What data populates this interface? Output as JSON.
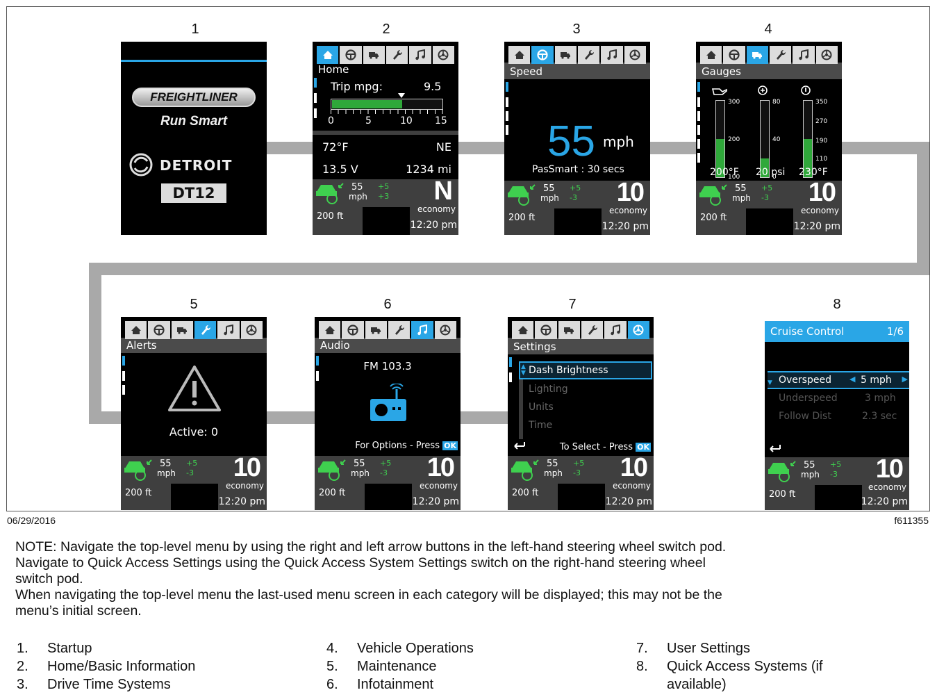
{
  "screens": [
    {
      "num": "1",
      "title": "",
      "brand1": "FREIGHTLINER",
      "brand2": "Run Smart",
      "brand3": "DETROIT",
      "brand4": "DT12"
    },
    {
      "num": "2",
      "title": "Home",
      "trip_label": "Trip mpg:",
      "trip_value": "9.5",
      "scale": [
        "0",
        "5",
        "10",
        "15"
      ],
      "temp": "72°F",
      "heading": "NE",
      "voltage": "13.5 V",
      "odometer": "1234 mi",
      "gear": "N"
    },
    {
      "num": "3",
      "title": "Speed",
      "speed": "55",
      "unit": "mph",
      "passmart": "PasSmart : 30 secs",
      "gear": "10"
    },
    {
      "num": "4",
      "title": "Gauges",
      "gauge1": {
        "max": "300",
        "mid": "200",
        "min": "100",
        "value": "200°F"
      },
      "gauge2": {
        "max": "80",
        "mid": "40",
        "min": "0",
        "value": "20 psi"
      },
      "gauge3": {
        "max": "350",
        "t2": "270",
        "t3": "190",
        "min": "110",
        "value": "230°F"
      },
      "gear": "10"
    },
    {
      "num": "5",
      "title": "Alerts",
      "active": "Active: 0",
      "gear": "10"
    },
    {
      "num": "6",
      "title": "Audio",
      "station": "FM 103.3",
      "options": "For Options - Press",
      "ok": "OK",
      "gear": "10"
    },
    {
      "num": "7",
      "title": "Settings",
      "items": [
        "Dash Brightness",
        "Lighting",
        "Units",
        "Time"
      ],
      "select": "To Select - Press",
      "ok": "OK",
      "gear": "10"
    },
    {
      "num": "8",
      "title": "Cruise Control",
      "page": "1/6",
      "rows": [
        {
          "label": "Overspeed",
          "value": "5 mph"
        },
        {
          "label": "Underspeed",
          "value": "3 mph"
        },
        {
          "label": "Follow Dist",
          "value": "2.3 sec"
        }
      ],
      "gear": "10"
    }
  ],
  "status": {
    "speed": "55",
    "unit": "mph",
    "plus": "+5",
    "minus": "-3",
    "minus_n": "+3",
    "economy": "economy",
    "time": "12:20 pm",
    "distance": "200 ft"
  },
  "footer": {
    "date": "06/29/2016",
    "code": "f611355"
  },
  "note": [
    "NOTE: Navigate the top-level menu by using the right and left arrow buttons in the left-hand steering wheel switch pod.",
    "Navigate to Quick Access Settings using the Quick Access System Settings switch on the right-hand steering wheel",
    "switch pod.",
    "When navigating the top-level menu the last-used menu screen in each category will be displayed; this may not be the",
    "menu’s initial screen."
  ],
  "legend": [
    {
      "n": "1.",
      "label": "Startup"
    },
    {
      "n": "2.",
      "label": "Home/Basic Information"
    },
    {
      "n": "3.",
      "label": "Drive Time Systems"
    },
    {
      "n": "4.",
      "label": "Vehicle Operations"
    },
    {
      "n": "5.",
      "label": "Maintenance"
    },
    {
      "n": "6.",
      "label": "Infotainment"
    },
    {
      "n": "7.",
      "label": "User Settings"
    },
    {
      "n": "8.",
      "label": "Quick Access Systems (if"
    },
    {
      "n": "",
      "label": "available)"
    }
  ],
  "colors": {
    "accent": "#2aa6e6",
    "positive": "#3fd04f",
    "path": "#a9a9a9",
    "gauge": "#2fa83a"
  },
  "icons": [
    "home-icon",
    "steering-wheel-icon",
    "truck-icon",
    "wrench-icon",
    "music-note-icon",
    "settings-wheel-icon",
    "warning-triangle-icon",
    "radio-icon",
    "back-arrow-icon",
    "cruise-car-icon"
  ]
}
